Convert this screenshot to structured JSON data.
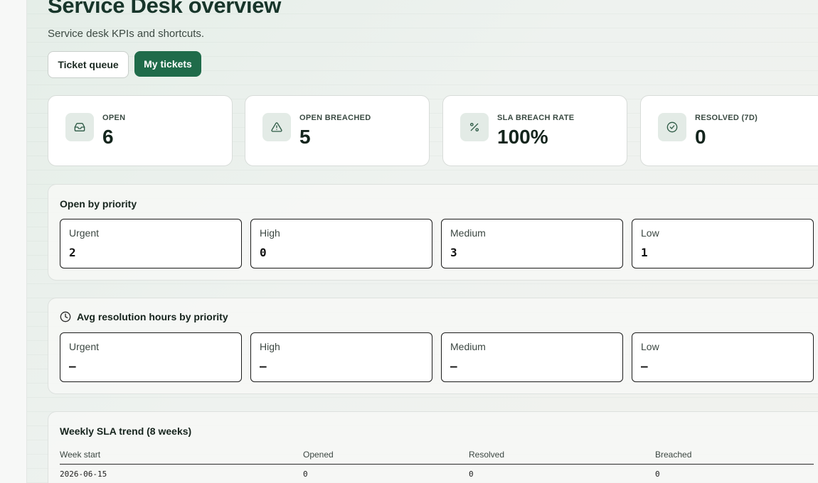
{
  "header": {
    "title": "Service Desk overview",
    "subtitle": "Service desk KPIs and shortcuts."
  },
  "actions": {
    "ticket_queue": "Ticket queue",
    "my_tickets": "My tickets"
  },
  "kpis": [
    {
      "label": "OPEN",
      "value": "6",
      "icon": "inbox-icon"
    },
    {
      "label": "OPEN BREACHED",
      "value": "5",
      "icon": "alert-triangle-icon"
    },
    {
      "label": "SLA BREACH RATE",
      "value": "100%",
      "icon": "percent-icon"
    },
    {
      "label": "RESOLVED (7D)",
      "value": "0",
      "icon": "check-circle-icon"
    }
  ],
  "open_by_priority": {
    "title": "Open by priority",
    "items": [
      {
        "label": "Urgent",
        "value": "2"
      },
      {
        "label": "High",
        "value": "0"
      },
      {
        "label": "Medium",
        "value": "3"
      },
      {
        "label": "Low",
        "value": "1"
      }
    ]
  },
  "avg_resolution": {
    "title": "Avg resolution hours by priority",
    "icon": "clock-icon",
    "items": [
      {
        "label": "Urgent",
        "value": "—"
      },
      {
        "label": "High",
        "value": "—"
      },
      {
        "label": "Medium",
        "value": "—"
      },
      {
        "label": "Low",
        "value": "—"
      }
    ]
  },
  "weekly_trend": {
    "title": "Weekly SLA trend (8 weeks)",
    "columns": [
      "Week start",
      "Opened",
      "Resolved",
      "Breached"
    ],
    "rows": [
      [
        "2026-06-15",
        "0",
        "0",
        "0"
      ]
    ]
  },
  "colors": {
    "accent": "#1f6b4a",
    "icon_bg": "#e3ebe6"
  }
}
